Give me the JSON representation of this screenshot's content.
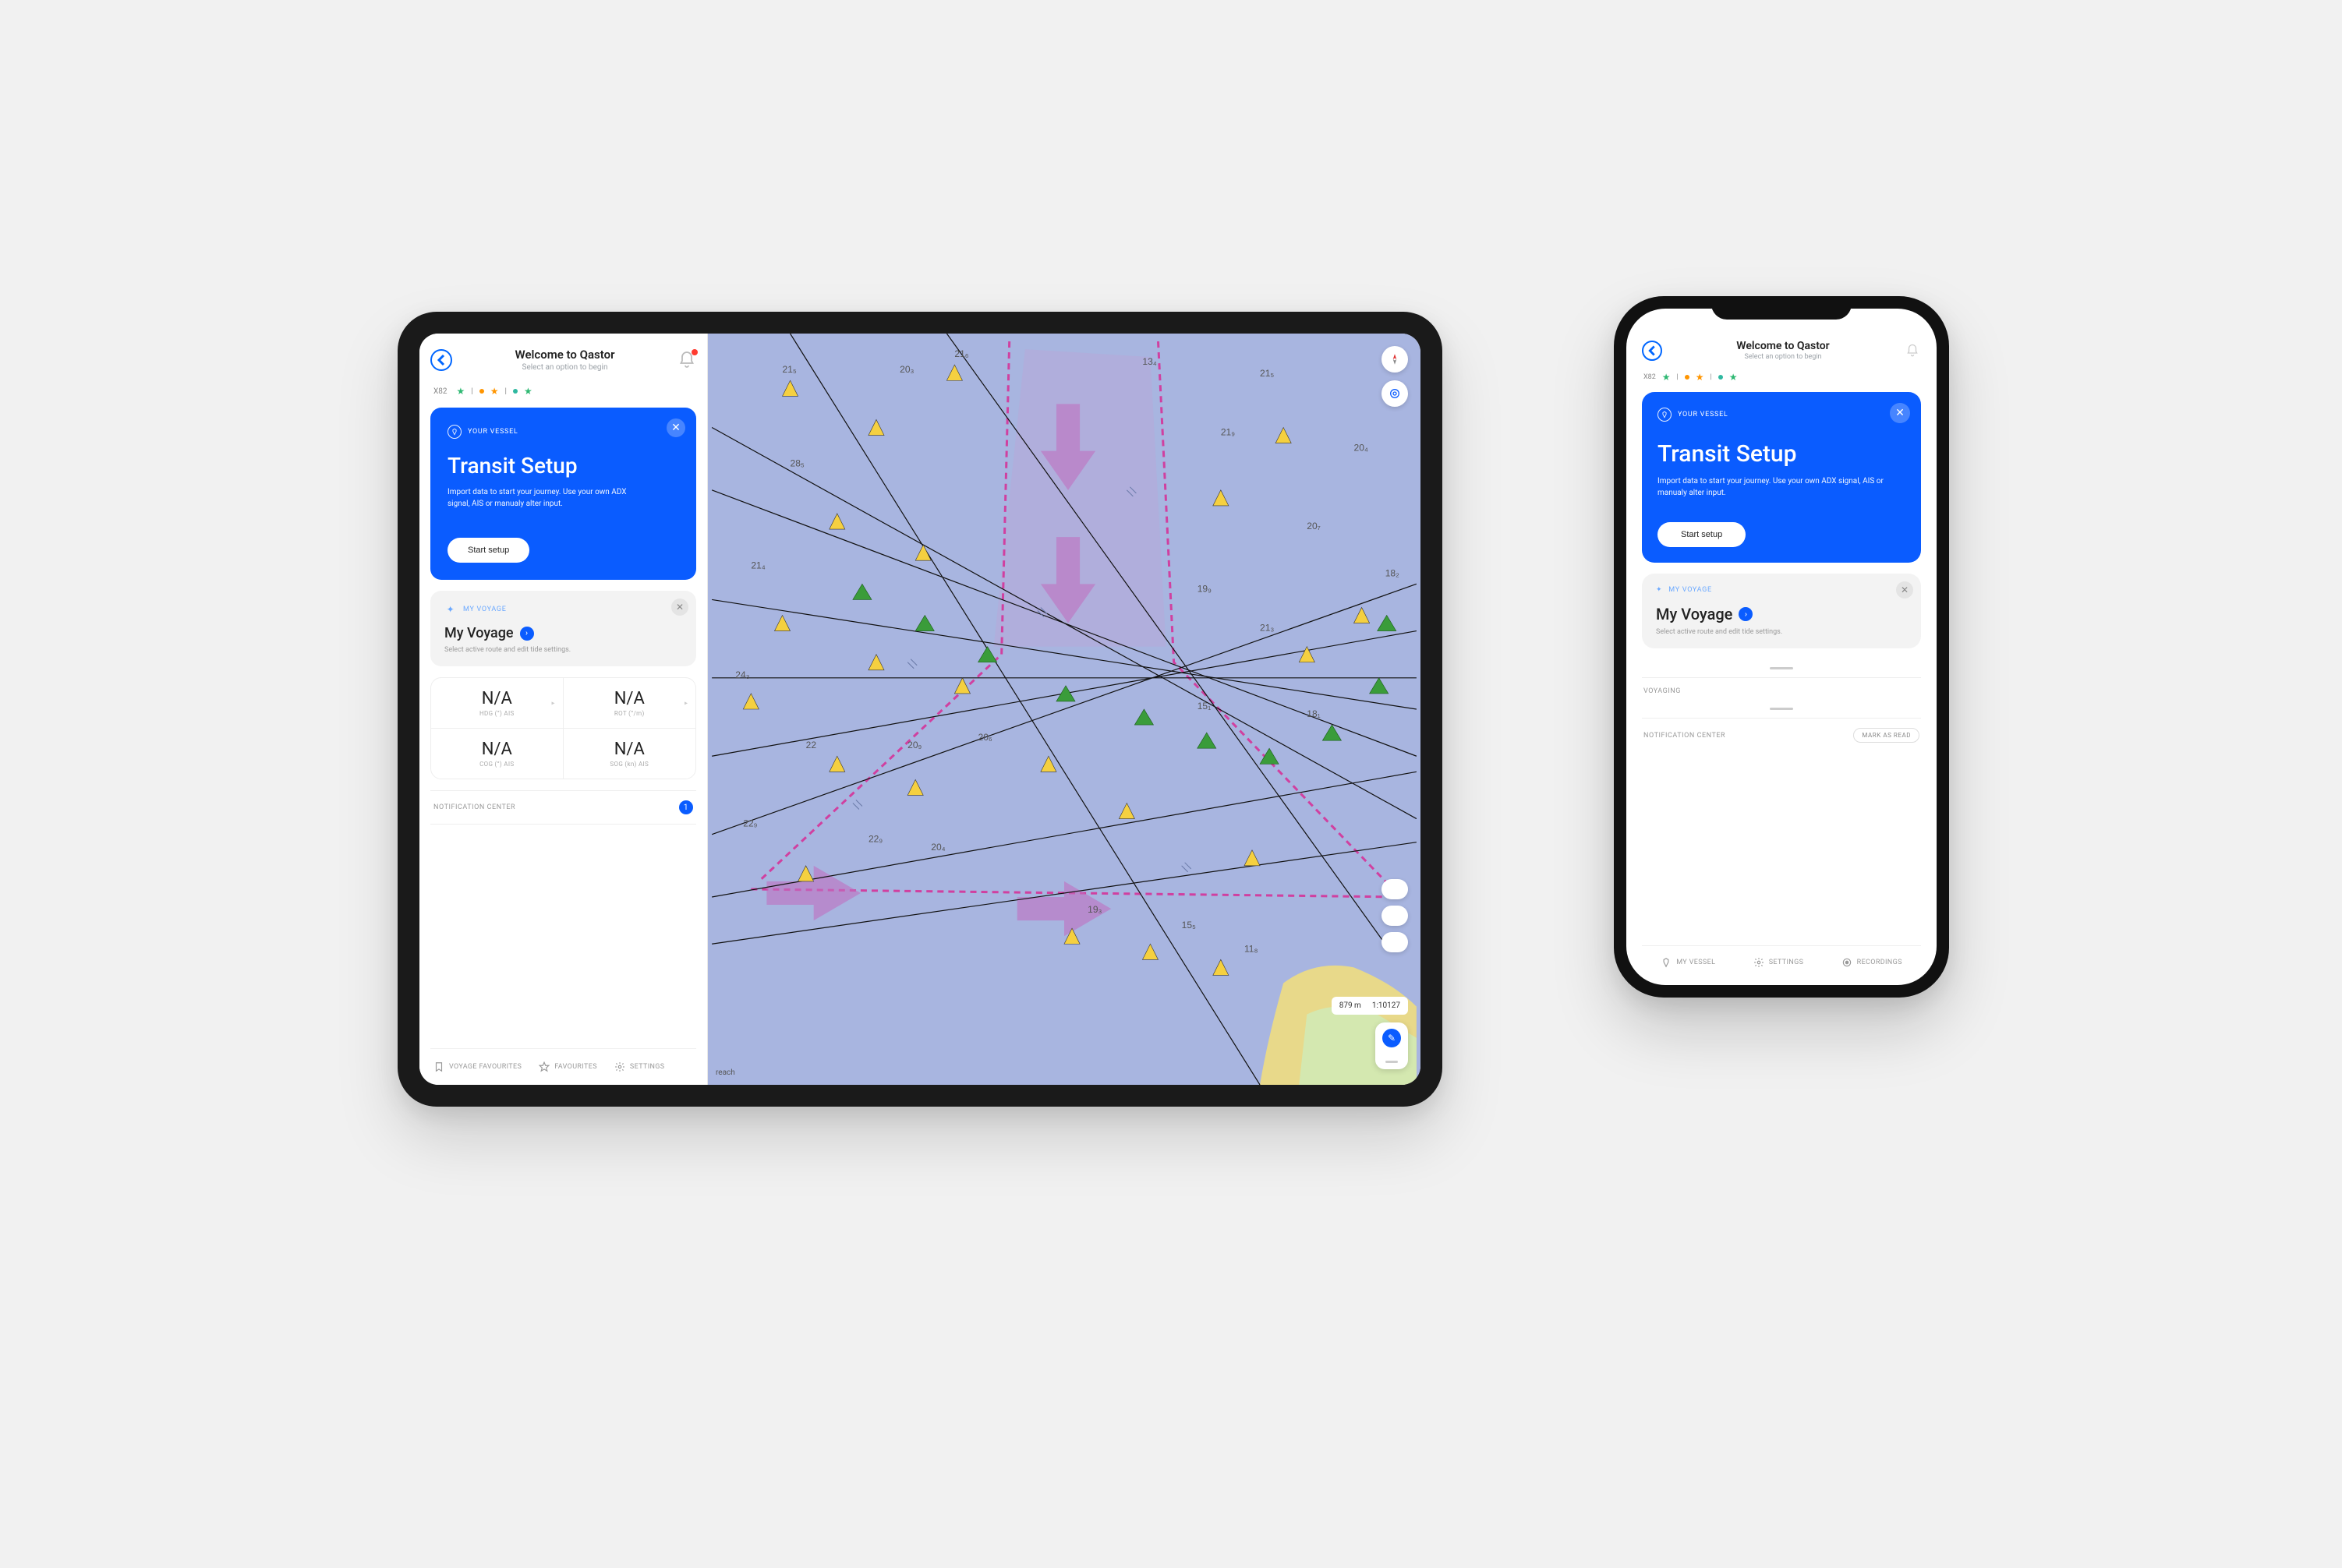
{
  "tablet": {
    "header": {
      "title": "Welcome to Qastor",
      "subtitle": "Select an option to begin"
    },
    "status": {
      "label": "X82",
      "indicators": [
        {
          "type": "star",
          "color": "#2eb872"
        },
        {
          "type": "dot",
          "color": "#ff9500"
        },
        {
          "type": "star",
          "color": "#ff9500"
        },
        {
          "type": "dot",
          "color": "#2eb8a0"
        },
        {
          "type": "star",
          "color": "#2eb872"
        }
      ]
    },
    "vessel_card": {
      "badge": "YOUR VESSEL",
      "title": "Transit Setup",
      "desc": "Import data to start your journey. Use your own ADX signal, AIS or manualy alter input.",
      "button": "Start setup"
    },
    "voyage_card": {
      "badge": "MY VOYAGE",
      "title": "My Voyage",
      "sub": "Select active route and edit tide settings."
    },
    "metrics": [
      {
        "val": "N/A",
        "lbl": "HDG (°) AIS"
      },
      {
        "val": "N/A",
        "lbl": "ROT (°/m)"
      },
      {
        "val": "N/A",
        "lbl": "COG (°) AIS"
      },
      {
        "val": "N/A",
        "lbl": "SOG (kn) AIS"
      }
    ],
    "notif": {
      "label": "NOTIFICATION CENTER",
      "count": "1"
    },
    "bottom_nav": {
      "fav": "VOYAGE FAVOURITES",
      "favs": "FAVOURITES",
      "settings": "SETTINGS"
    },
    "map": {
      "scale_distance": "879 m",
      "scale_ratio": "1:10127",
      "bottom_label": "reach",
      "depths": [
        "21.5",
        "20.3",
        "21.6",
        "13.4",
        "21.5",
        "28.5",
        "21.9",
        "21.4",
        "19.9",
        "21.9",
        "20.4",
        "18.2",
        "24.3",
        "22",
        "20.7",
        "20.4",
        "20.5",
        "20.9",
        "20.6",
        "15.1",
        "21.3",
        "22.9",
        "20.4",
        "18.1",
        "19.3",
        "15.5",
        "11.8"
      ]
    }
  },
  "phone": {
    "header": {
      "title": "Welcome to Qastor",
      "subtitle": "Select an option to begin"
    },
    "status": {
      "label": "X82",
      "indicators": [
        {
          "type": "star",
          "color": "#2eb872"
        },
        {
          "type": "dot",
          "color": "#ff9500"
        },
        {
          "type": "star",
          "color": "#ff9500"
        },
        {
          "type": "dot",
          "color": "#2eb8a0"
        },
        {
          "type": "star",
          "color": "#2eb872"
        }
      ]
    },
    "vessel_card": {
      "badge": "YOUR VESSEL",
      "title": "Transit Setup",
      "desc": "Import data to start your journey. Use your own ADX signal, AIS or manualy alter input.",
      "button": "Start setup"
    },
    "voyage_card": {
      "badge": "MY VOYAGE",
      "title": "My Voyage",
      "sub": "Select active route and edit tide settings."
    },
    "sections": {
      "voyaging": "VOYAGING",
      "notif": "NOTIFICATION CENTER",
      "mark_read": "MARK AS READ"
    },
    "bottom_nav": {
      "vessel": "MY VESSEL",
      "settings": "SETTINGS",
      "recordings": "RECORDINGS"
    }
  }
}
